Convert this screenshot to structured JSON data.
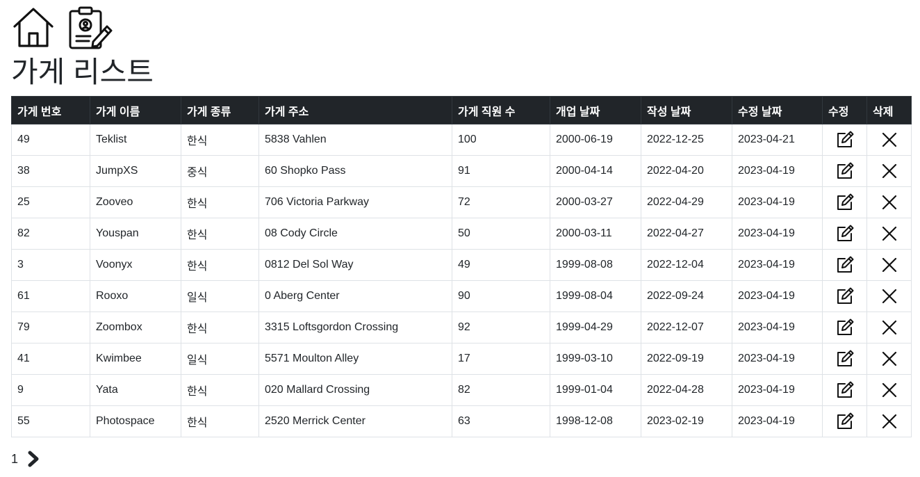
{
  "nav": {
    "home_icon": "home-icon",
    "form_icon": "clipboard-edit-icon"
  },
  "page": {
    "title": "가게 리스트"
  },
  "table": {
    "headers": [
      "가게 번호",
      "가게 이름",
      "가게 종류",
      "가게 주소",
      "가게 직원 수",
      "개업 날짜",
      "작성 날짜",
      "수정 날짜",
      "수정",
      "삭제"
    ],
    "edit_icon": "edit-icon",
    "delete_icon": "close-icon",
    "rows": [
      {
        "id": "49",
        "name": "Teklist",
        "type": "한식",
        "address": "5838 Vahlen",
        "staff": "100",
        "opened": "2000-06-19",
        "created": "2022-12-25",
        "modified": "2023-04-21"
      },
      {
        "id": "38",
        "name": "JumpXS",
        "type": "중식",
        "address": "60 Shopko Pass",
        "staff": "91",
        "opened": "2000-04-14",
        "created": "2022-04-20",
        "modified": "2023-04-19"
      },
      {
        "id": "25",
        "name": "Zooveo",
        "type": "한식",
        "address": "706 Victoria Parkway",
        "staff": "72",
        "opened": "2000-03-27",
        "created": "2022-04-29",
        "modified": "2023-04-19"
      },
      {
        "id": "82",
        "name": "Youspan",
        "type": "한식",
        "address": "08 Cody Circle",
        "staff": "50",
        "opened": "2000-03-11",
        "created": "2022-04-27",
        "modified": "2023-04-19"
      },
      {
        "id": "3",
        "name": "Voonyx",
        "type": "한식",
        "address": "0812 Del Sol Way",
        "staff": "49",
        "opened": "1999-08-08",
        "created": "2022-12-04",
        "modified": "2023-04-19"
      },
      {
        "id": "61",
        "name": "Rooxo",
        "type": "일식",
        "address": "0 Aberg Center",
        "staff": "90",
        "opened": "1999-08-04",
        "created": "2022-09-24",
        "modified": "2023-04-19"
      },
      {
        "id": "79",
        "name": "Zoombox",
        "type": "한식",
        "address": "3315 Loftsgordon Crossing",
        "staff": "92",
        "opened": "1999-04-29",
        "created": "2022-12-07",
        "modified": "2023-04-19"
      },
      {
        "id": "41",
        "name": "Kwimbee",
        "type": "일식",
        "address": "5571 Moulton Alley",
        "staff": "17",
        "opened": "1999-03-10",
        "created": "2022-09-19",
        "modified": "2023-04-19"
      },
      {
        "id": "9",
        "name": "Yata",
        "type": "한식",
        "address": "020 Mallard Crossing",
        "staff": "82",
        "opened": "1999-01-04",
        "created": "2022-04-28",
        "modified": "2023-04-19"
      },
      {
        "id": "55",
        "name": "Photospace",
        "type": "한식",
        "address": "2520 Merrick Center",
        "staff": "63",
        "opened": "1998-12-08",
        "created": "2023-02-19",
        "modified": "2023-04-19"
      }
    ]
  },
  "pagination": {
    "current_page": "1",
    "next_icon": "chevron-right-icon"
  }
}
